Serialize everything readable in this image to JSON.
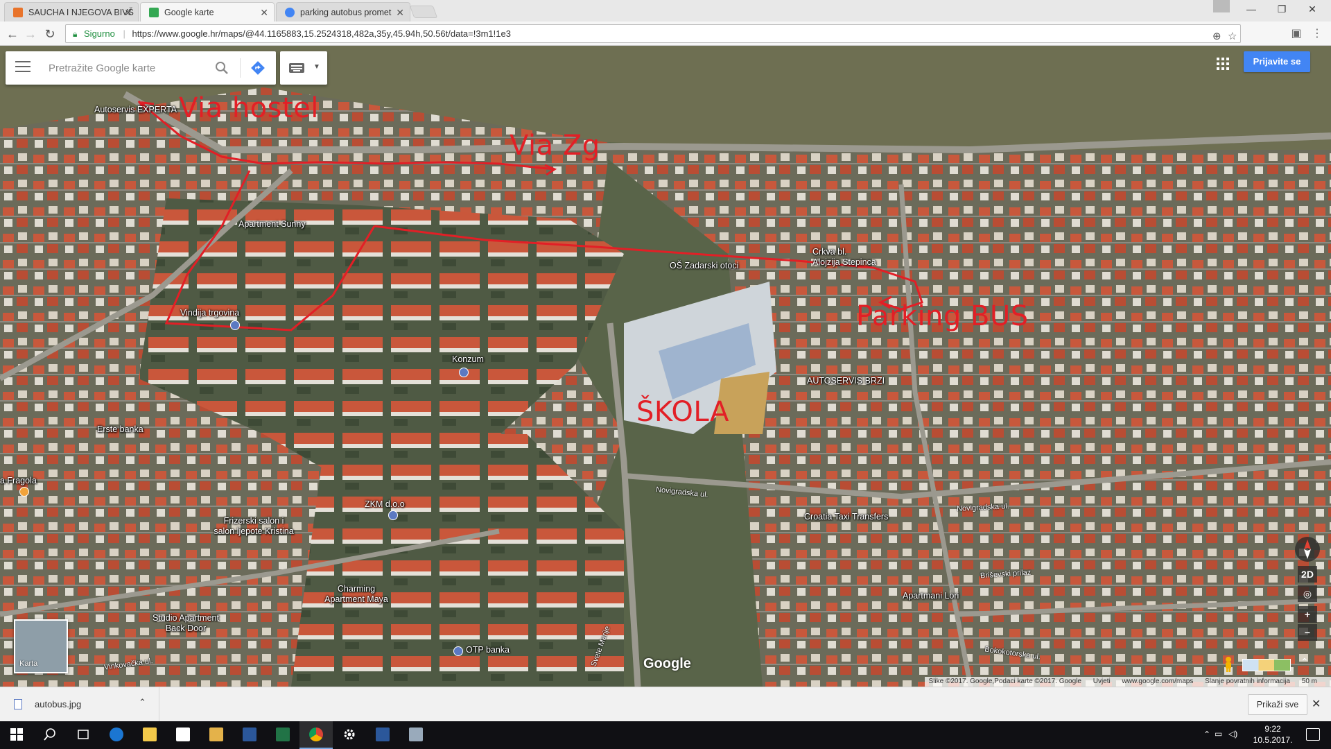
{
  "browser": {
    "tabs": [
      {
        "title": "SAUCHA I NJEGOVA BIVŠ",
        "favicon_color": "#e8732a",
        "active": false
      },
      {
        "title": "Google karte",
        "favicon_color": "#34a853",
        "active": true
      },
      {
        "title": "parking autobus promet",
        "favicon_color": "#4285f4",
        "active": false
      }
    ],
    "tab_close": "✕",
    "secure_label": "Sigurno",
    "url": "https://www.google.hr/maps/@44.1165883,15.2524318,482a,35y,45.94h,50.56t/data=!3m1!1e3",
    "window_controls": {
      "minimize": "—",
      "maximize": "❐",
      "close": "✕"
    }
  },
  "maps": {
    "search_placeholder": "Pretražite Google karte",
    "signin_label": "Prijavite se",
    "layer_label": "Karta",
    "google_logo": "Google",
    "mode_2d": "2D",
    "zoom_in": "+",
    "zoom_out": "−",
    "attribution": [
      "Slike ©2017. Google,Podaci karte ©2017. Google",
      "Uvjeti",
      "www.google.com/maps",
      "Slanje povratnih informacija",
      "50 m"
    ],
    "pois": [
      {
        "key": "autoservis_experta",
        "label": "Autoservis EXPERTA"
      },
      {
        "key": "apartment_sunny",
        "label": "Apartment Sunny"
      },
      {
        "key": "vindija",
        "label": "Vindija trgovina"
      },
      {
        "key": "konzum",
        "label": "Konzum"
      },
      {
        "key": "erste",
        "label": "Erste banka"
      },
      {
        "key": "fragola",
        "label": "a Fragola"
      },
      {
        "key": "zkm",
        "label": "ZKM d.o.o"
      },
      {
        "key": "frizerski",
        "label": "Frizerski salon i\nsalon ljepote Kristina"
      },
      {
        "key": "charming",
        "label": "Charming\nApartment Maya"
      },
      {
        "key": "studio",
        "label": "Studio Apartment\nBack Door"
      },
      {
        "key": "otp",
        "label": "OTP banka"
      },
      {
        "key": "os_zadarski",
        "label": "OŠ Zadarski otoci"
      },
      {
        "key": "crkva",
        "label": "Crkva bl.\nAlojzija Stepinca"
      },
      {
        "key": "autoservis_brzi",
        "label": "AUTOSERVIS BRZI"
      },
      {
        "key": "taxi",
        "label": "Croatia Taxi Transfers"
      },
      {
        "key": "lori",
        "label": "Apartmani Lori"
      }
    ],
    "roads": [
      {
        "key": "novigradska1",
        "label": "Novigradska ul."
      },
      {
        "key": "novigradska2",
        "label": "Novigradska ul."
      },
      {
        "key": "brisevski",
        "label": "Briševski prilaz"
      },
      {
        "key": "bokokotorska",
        "label": "Bokokotorska ul."
      },
      {
        "key": "vinkovacka",
        "label": "Vinkovačka ul."
      },
      {
        "key": "svete_marije",
        "label": "Svete Marije"
      }
    ],
    "annotations": {
      "via_hostel": "Via hostel",
      "via_zg": "Via Zg",
      "parking_bus": "Parking BUS",
      "skola": "ŠKOLA"
    },
    "annotation_color": "#e21f26"
  },
  "downloads": {
    "file_name": "autobus.jpg",
    "show_all_label": "Prikaži sve"
  },
  "taskbar": {
    "time": "9:22",
    "date": "10.5.2017."
  }
}
